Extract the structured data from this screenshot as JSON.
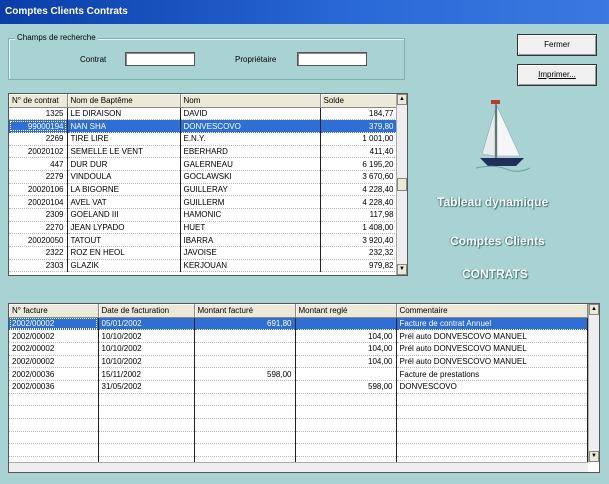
{
  "window": {
    "title": "Comptes Clients Contrats"
  },
  "search": {
    "legend": "Champs de recherche",
    "contrat_label": "Contrat",
    "contrat_value": "",
    "proprietaire_label": "Propriétaire",
    "proprietaire_value": ""
  },
  "buttons": {
    "fermer": "Fermer",
    "imprimer": "Imprimer..."
  },
  "side": {
    "line1": "Tableau dynamique",
    "line2": "Comptes Clients",
    "line3": "CONTRATS",
    "boat_icon": "sailboat-icon"
  },
  "contracts": {
    "headers": [
      "N° de contrat",
      "Nom de Baptême",
      "Nom",
      "Solde"
    ],
    "selected_index": 1,
    "rows": [
      [
        "1325",
        "LE DIRAISON",
        "DAVID",
        "184,77"
      ],
      [
        "99000194",
        "NAN SHA",
        "DONVESCOVO",
        "379,80"
      ],
      [
        "2269",
        "TIRE LIRE",
        "E.N.Y.",
        "1 001,00"
      ],
      [
        "20020102",
        "SEMELLE LE VENT",
        "EBERHARD",
        "411,40"
      ],
      [
        "447",
        "DUR DUR",
        "GALERNEAU",
        "6 195,20"
      ],
      [
        "2279",
        "VINDOULA",
        "GOCLAWSKI",
        "3 670,60"
      ],
      [
        "20020106",
        "LA BIGORNE",
        "GUILLERAY",
        "4 228,40"
      ],
      [
        "20020104",
        "AVEL VAT",
        "GUILLERM",
        "4 228,40"
      ],
      [
        "2309",
        "GOELAND III",
        "HAMONIC",
        "117,98"
      ],
      [
        "2270",
        "JEAN LYPADO",
        "HUET",
        "1 408,00"
      ],
      [
        "20020050",
        "TATOUT",
        "IBARRA",
        "3 920,40"
      ],
      [
        "2322",
        "ROZ EN HEOL",
        "JAVOISE",
        "232,32"
      ],
      [
        "2303",
        "GLAZIK",
        "KERJOUAN",
        "979,82"
      ]
    ]
  },
  "invoices": {
    "headers": [
      "N° facture",
      "Date de facturation",
      "Montant facturé",
      "Montant reglé",
      "Commentaire"
    ],
    "selected_index": 0,
    "rows": [
      [
        "2002/00002",
        "05/01/2002",
        "691,80",
        "",
        "Facture de contrat Annuel"
      ],
      [
        "2002/00002",
        "10/10/2002",
        "",
        "104,00",
        "Prél auto DONVESCOVO MANUEL"
      ],
      [
        "2002/00002",
        "10/10/2002",
        "",
        "104,00",
        "Prél auto DONVESCOVO MANUEL"
      ],
      [
        "2002/00002",
        "10/10/2002",
        "",
        "104,00",
        "Prél auto DONVESCOVO MANUEL"
      ],
      [
        "2002/00036",
        "15/11/2002",
        "598,00",
        "",
        "Facture de prestations"
      ],
      [
        "2002/00036",
        "31/05/2002",
        "",
        "598,00",
        "DONVESCOVO"
      ]
    ],
    "empty_rows": 7
  },
  "colors": {
    "background": "#a9d3d3",
    "selection": "#2f6fd4",
    "titlebar": "#0a3da8"
  }
}
